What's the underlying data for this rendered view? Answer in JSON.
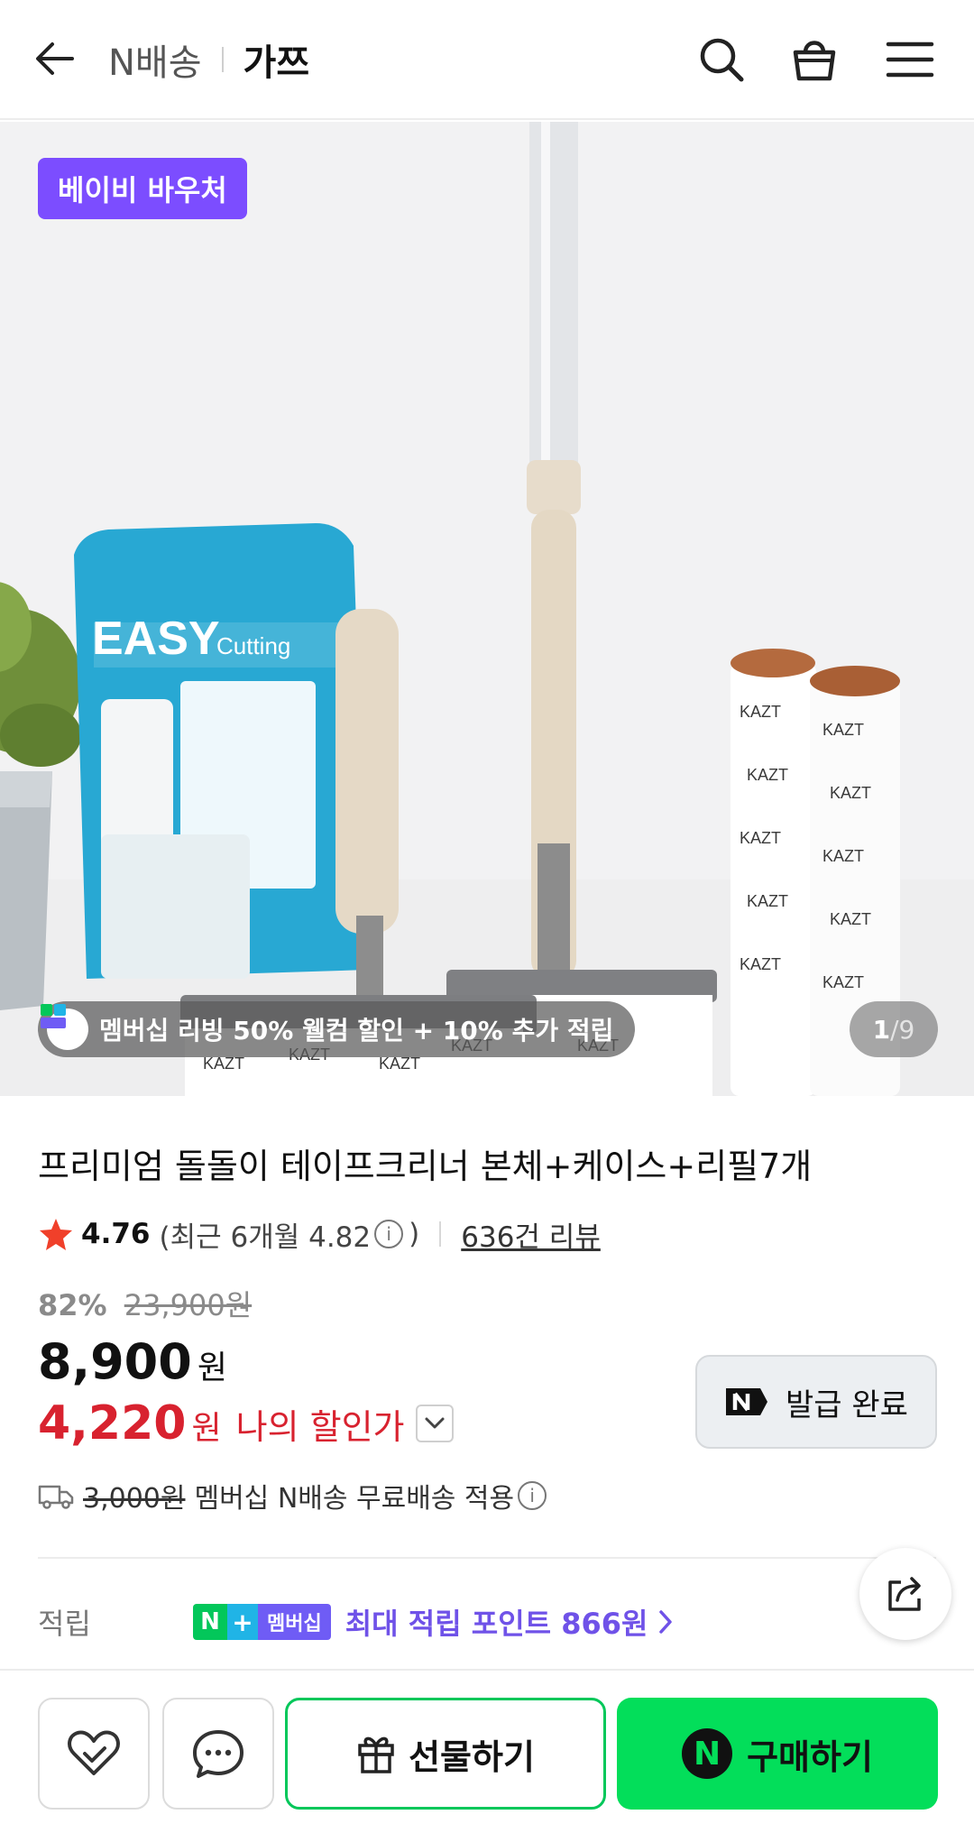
{
  "header": {
    "back_icon": "arrow-left-icon",
    "service_label": "N배송",
    "store_name": "가쯔",
    "search_icon": "search-icon",
    "cart_icon": "shopping-bag-icon",
    "menu_icon": "hamburger-menu-icon"
  },
  "gallery": {
    "voucher_badge": "베이비 바우처",
    "promo_text": "멤버십 리빙 50% 웰컴 할인 + 10% 추가 적립",
    "page_current": "1",
    "page_total": "/9"
  },
  "product": {
    "title": "프리미엄 돌돌이 테이프크리너 본체+케이스+리필7개",
    "rating": "4.76",
    "rating_recent_prefix": "(최근 6개월 4.82",
    "rating_recent_suffix": ")",
    "review_count": "636건 리뷰",
    "discount_rate": "82%",
    "original_price": "23,900원",
    "price": "8,900",
    "price_unit": "원",
    "my_price": "4,220",
    "my_price_unit": "원",
    "my_price_label": "나의 할인가",
    "coupon_label": "발급 완료",
    "shipping_original": "3,000원",
    "shipping_text": "멤버십 N배송 무료배송 적용",
    "points_label": "적립",
    "points_badge_membership": "멤버십",
    "points_text": "최대 적립 포인트 866원"
  },
  "bottom_bar": {
    "like_icon": "heart-icon",
    "talk_icon": "chat-icon",
    "gift_label": "선물하기",
    "buy_label": "구매하기"
  },
  "colors": {
    "voucher_purple": "#7c4dff",
    "discount_red": "#d8222f",
    "naver_green": "#03c75a",
    "buy_green": "#03de5a",
    "points_purple": "#6f52e8"
  }
}
